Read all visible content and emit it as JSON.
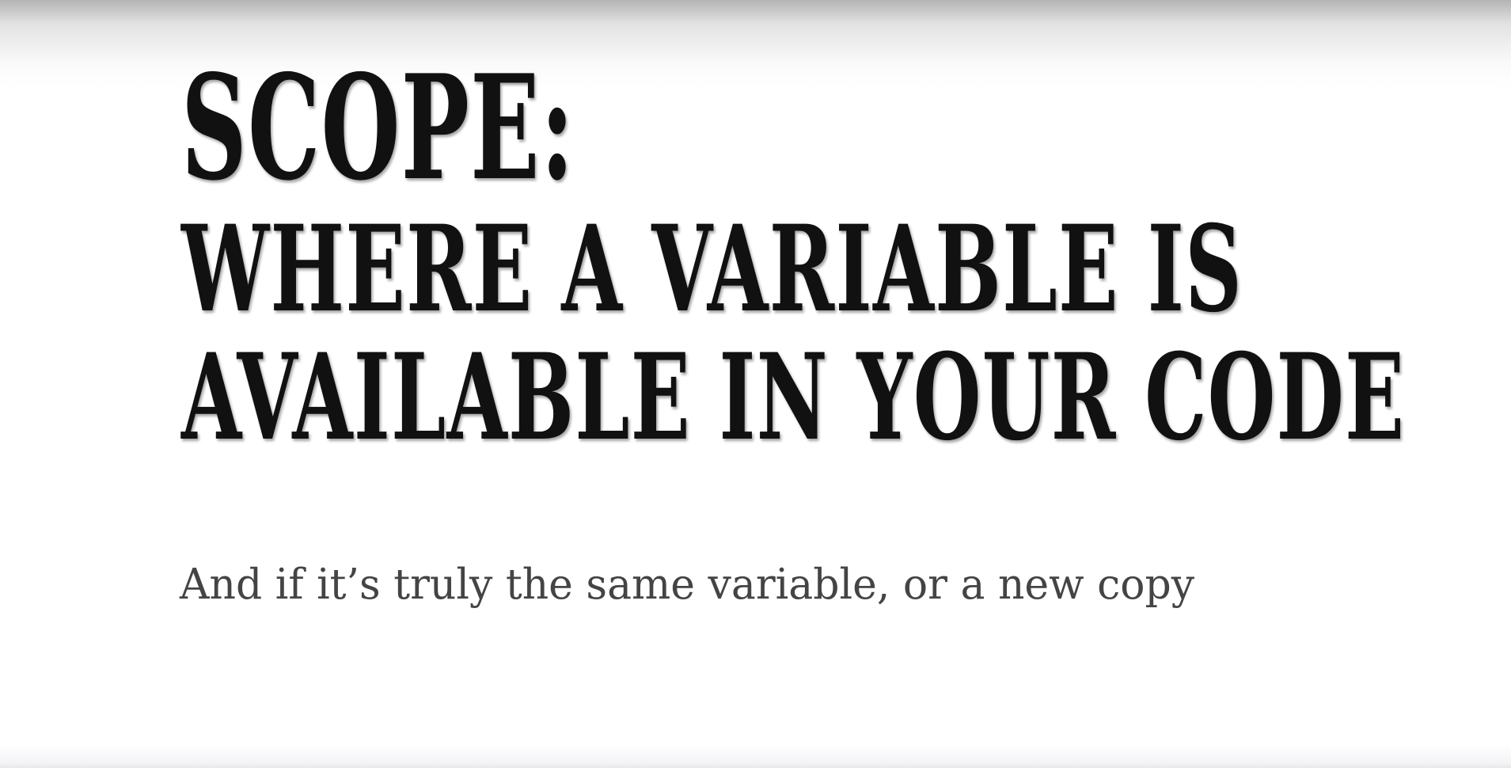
{
  "slide": {
    "title_lines": [
      "SCOPE:",
      "WHERE A VARIABLE IS",
      "AVAILABLE IN YOUR CODE"
    ],
    "subtitle": "And if it’s truly the same variable, or a new copy"
  }
}
